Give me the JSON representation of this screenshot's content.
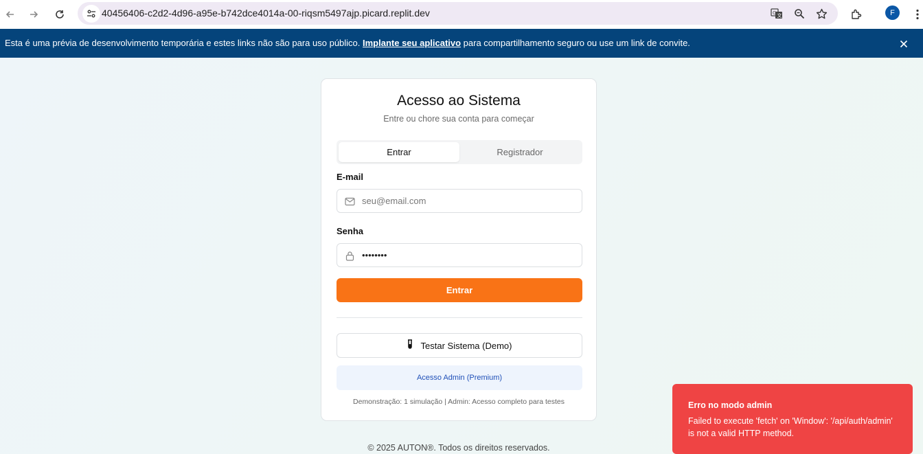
{
  "browser": {
    "url": "40456406-c2d2-4d96-a95e-b742dce4014a-00-riqsm5497ajp.picard.replit.dev",
    "profile_initial": "F"
  },
  "banner": {
    "text_before": "Esta é uma prévia de desenvolvimento temporária e estes links não são para uso público. ",
    "link": "Implante seu aplicativo",
    "text_after": " para compartilhamento seguro ou use um link de convite."
  },
  "login": {
    "title": "Acesso ao Sistema",
    "subtitle": "Entre ou chore sua conta para começar",
    "tabs": [
      {
        "label": "Entrar",
        "active": true
      },
      {
        "label": "Registrador",
        "active": false
      }
    ],
    "email_label": "E-mail",
    "email_placeholder": "seu@email.com",
    "password_label": "Senha",
    "password_value": "••••••••",
    "submit_label": "Entrar",
    "demo_label": "Testar Sistema (Demo)",
    "admin_label": "Acesso Admin (Premium)",
    "note": "Demonstração: 1 simulação | Admin: Acesso completo para testes"
  },
  "footer": "© 2025 AUTON®. Todos os direitos reservados.",
  "toast": {
    "title": "Erro no modo admin",
    "message": "Failed to execute 'fetch' on 'Window': '/api/auth/admin' is not a valid HTTP method."
  },
  "colors": {
    "banner_bg": "#05447b",
    "primary": "#f97316",
    "toast_bg": "#ef4444",
    "admin_bg": "#eef4fd"
  }
}
